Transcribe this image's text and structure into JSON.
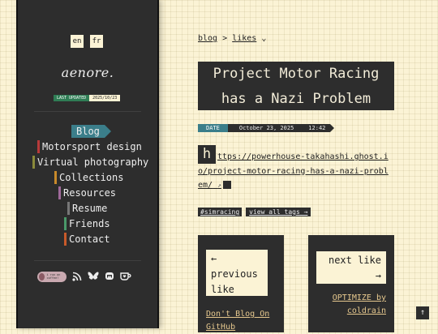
{
  "sidebar": {
    "lang_en": "en",
    "lang_fr": "fr",
    "logo": "aenore.",
    "updated_label": "LAST UPDATED",
    "updated_value": "2025/10/23",
    "nav": [
      {
        "label": "Blog",
        "color": "#3b7e8a"
      },
      {
        "label": "Motorsport design",
        "color": "#b83a3a"
      },
      {
        "label": "Virtual photography",
        "color": "#8a8a3a"
      },
      {
        "label": "Collections",
        "color": "#c98a2a"
      },
      {
        "label": "Resources",
        "color": "#a06a9a"
      },
      {
        "label": "Resume",
        "color": "#777777"
      },
      {
        "label": "Friends",
        "color": "#4a9a6a"
      },
      {
        "label": "Contact",
        "color": "#c85a2a"
      }
    ],
    "coffee_text": "i run on coffee!",
    "social_icons": [
      "coffee-icon",
      "rss-icon",
      "bluesky-icon",
      "mastodon-icon",
      "kofi-icon"
    ]
  },
  "breadcrumb": {
    "root": "blog",
    "sep": ">",
    "current": "likes",
    "chevron": "⌄"
  },
  "post": {
    "title_line1": "Project Motor Racing",
    "title_line2": "has a Nazi Problem",
    "date_label": "DATE",
    "date_value": "October 23, 2025",
    "time_value": "12:42",
    "dropcap": "h",
    "url": "ttps://powerhouse-takahashi.ghost.io/project-motor-racing-has-a-nazi-problem/",
    "tags": [
      "#simracing"
    ],
    "view_all_tags": "view all tags →"
  },
  "pagination": {
    "prev_arrow": "←",
    "prev_label_1": "previous",
    "prev_label_2": "like",
    "prev_title": "Don't Blog On GitHub",
    "next_label": "next like",
    "next_arrow": "→",
    "next_title": "OPTIMIZE by coldrain"
  },
  "back_to_top": "↑"
}
